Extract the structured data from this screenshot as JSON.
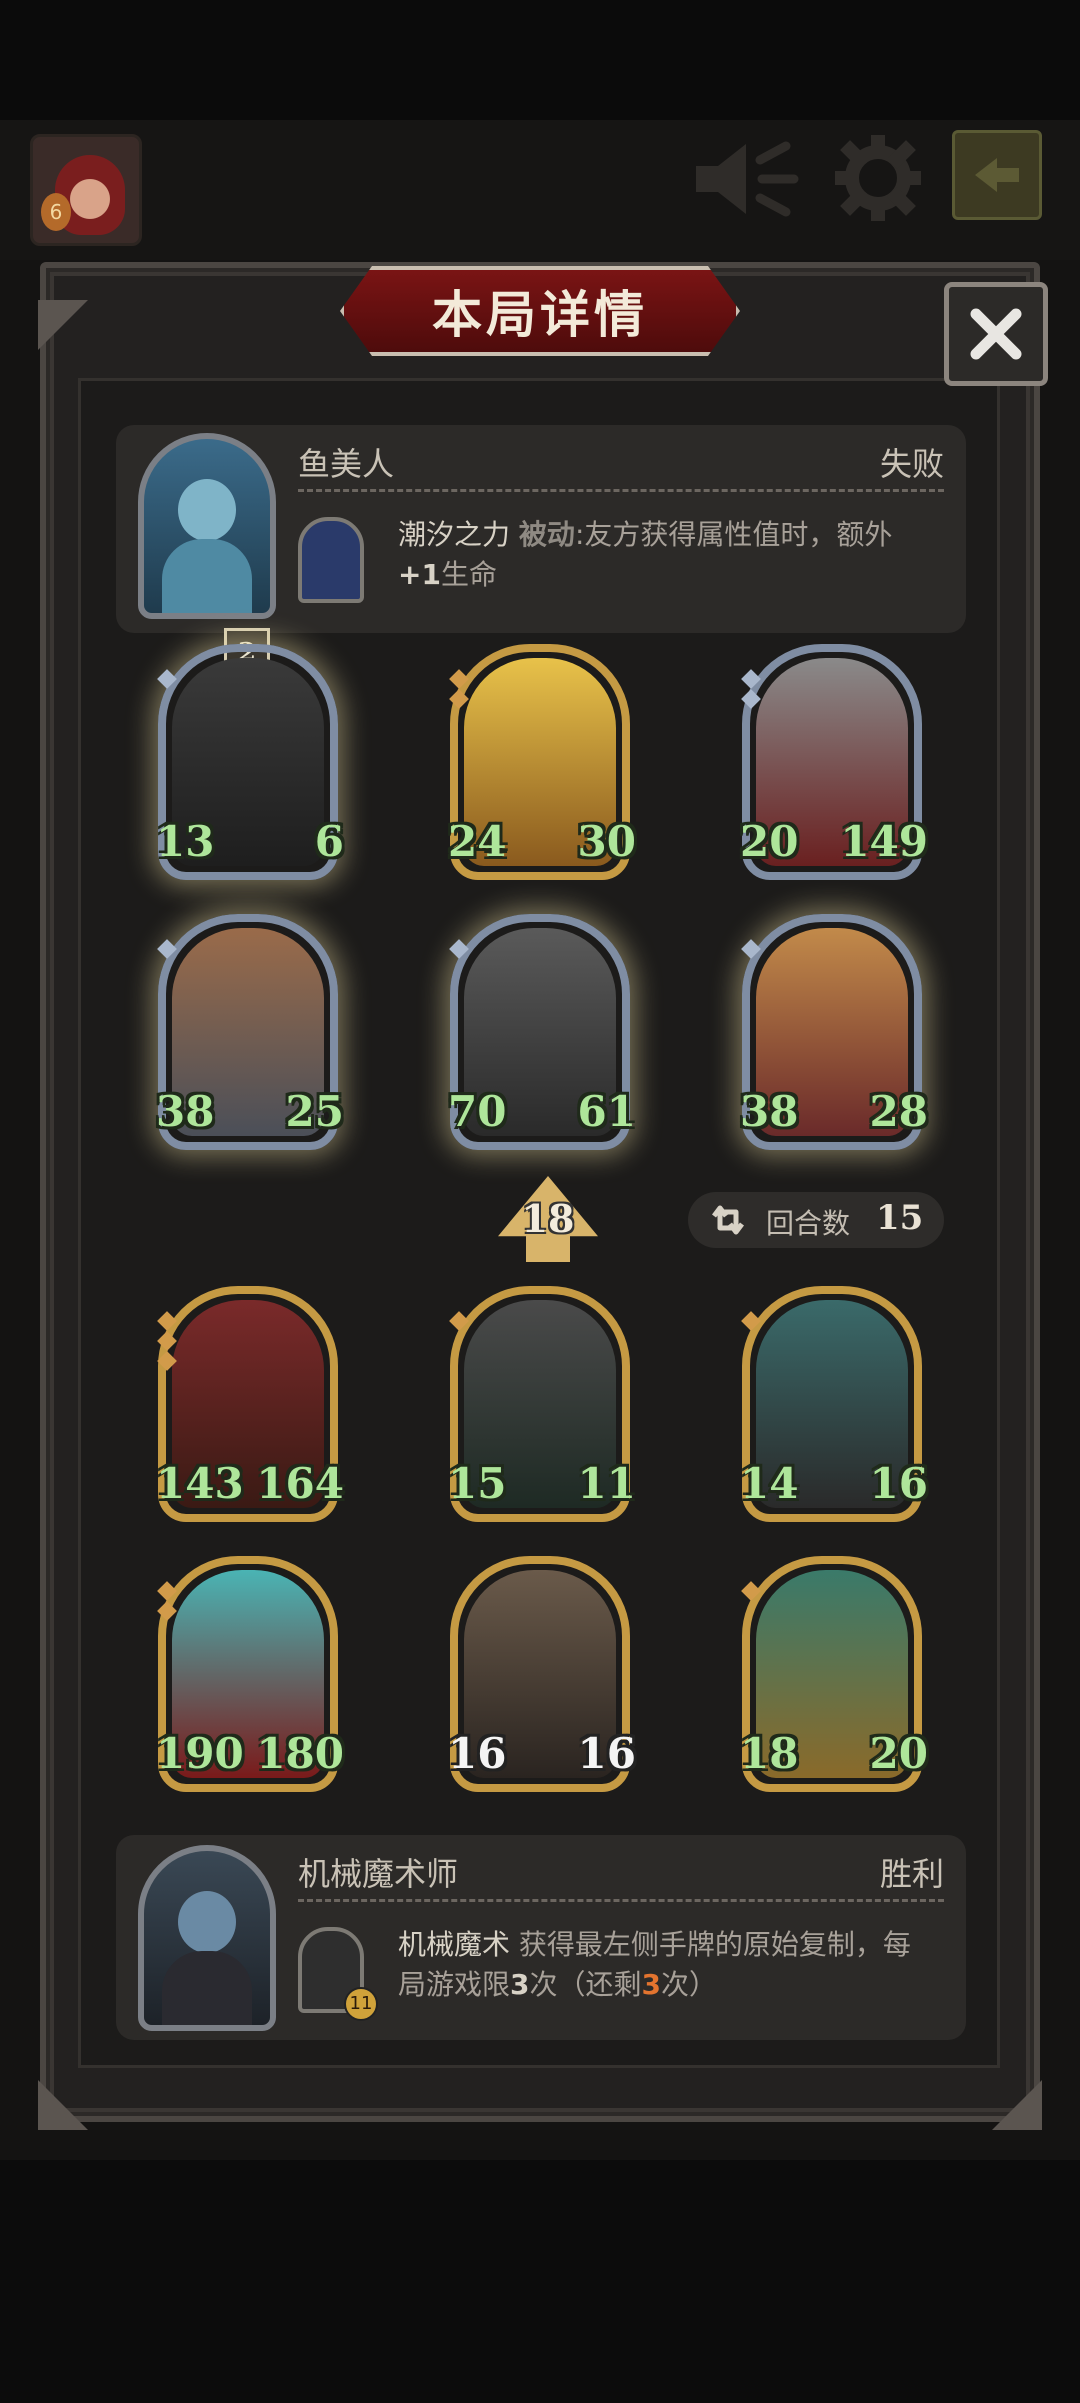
{
  "header": {
    "avatar_badge": "6",
    "exit_icon": "exit-arrow-icon",
    "mute_icon": "speaker-mute-icon",
    "settings_icon": "gear-icon"
  },
  "dialog": {
    "title": "本局详情",
    "close_icon": "close-x-icon"
  },
  "opponent": {
    "name": "鱼美人",
    "result": "失败",
    "skill_name": "潮汐之力",
    "skill_type": "被动",
    "skill_desc": ":友方获得属性值时，额外",
    "skill_bonus": "+1",
    "skill_desc_end": "生命"
  },
  "player": {
    "name": "机械魔术师",
    "result": "胜利",
    "skill_name": "机械魔术",
    "skill_desc_1": " 获得最左侧手牌的原始复制，每局游戏限",
    "limit": "3",
    "skill_desc_2": "次（还剩",
    "remaining": "3",
    "skill_desc_3": "次）",
    "skill_badge": "11"
  },
  "opponent_board": {
    "level": "2",
    "cards": [
      {
        "attack": "13",
        "health": "6"
      },
      {
        "attack": "24",
        "health": "30"
      },
      {
        "attack": "20",
        "health": "149"
      },
      {
        "attack": "38",
        "health": "25"
      },
      {
        "attack": "70",
        "health": "61"
      },
      {
        "attack": "38",
        "health": "28"
      }
    ]
  },
  "player_board": {
    "level": "18",
    "cards": [
      {
        "attack": "143",
        "health": "164"
      },
      {
        "attack": "15",
        "health": "11"
      },
      {
        "attack": "14",
        "health": "16"
      },
      {
        "attack": "190",
        "health": "180"
      },
      {
        "attack": "16",
        "health": "16"
      },
      {
        "attack": "18",
        "health": "20"
      }
    ]
  },
  "rounds": {
    "label": "回合数",
    "value": "15"
  },
  "colors": {
    "stat_green": "#aee69a",
    "gold_frame": "#c59a43",
    "silver_frame": "#7f8da3",
    "title_red": "#7a1414",
    "highlight_orange": "#e3742f"
  }
}
